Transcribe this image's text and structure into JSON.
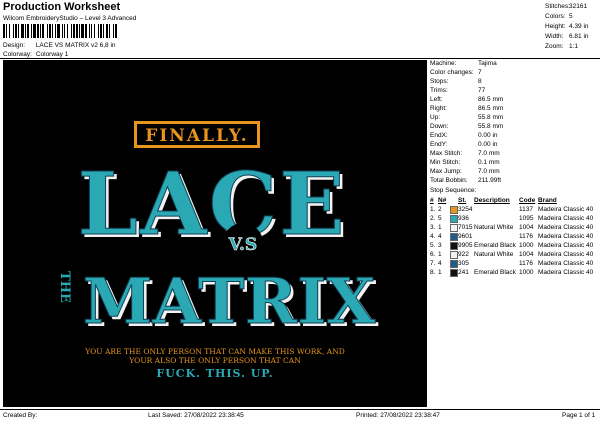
{
  "header": {
    "title": "Production Worksheet",
    "software": "Wilcom EmbroideryStudio – Level 3 Advanced"
  },
  "design_info": {
    "design_label": "Design:",
    "design_value": "LACE VS MATRIX v2 6,8 in",
    "colorway_label": "Colorway:",
    "colorway_value": "Colorway 1"
  },
  "stats": [
    {
      "key": "Stitches:",
      "value": "32161"
    },
    {
      "key": "Colors:",
      "value": "5"
    },
    {
      "key": "Height:",
      "value": "4.39 in"
    },
    {
      "key": "Width:",
      "value": "6.81 in"
    },
    {
      "key": "Zoom:",
      "value": "1:1"
    }
  ],
  "machine_info": [
    {
      "key": "Machine:",
      "value": "Tajima"
    },
    {
      "key": "Color changes:",
      "value": "7"
    },
    {
      "key": "Stops:",
      "value": "8"
    },
    {
      "key": "Trims:",
      "value": "77"
    },
    {
      "key": "Left:",
      "value": "86.5 mm"
    },
    {
      "key": "Right:",
      "value": "86.5 mm"
    },
    {
      "key": "Up:",
      "value": "55.8 mm"
    },
    {
      "key": "Down:",
      "value": "55.8 mm"
    },
    {
      "key": "EndX:",
      "value": "0.00 in"
    },
    {
      "key": "EndY:",
      "value": "0.00 in"
    },
    {
      "key": "Max Stitch:",
      "value": "7.0 mm"
    },
    {
      "key": "Min Stitch:",
      "value": "0.1 mm"
    },
    {
      "key": "Max Jump:",
      "value": "7.0 mm"
    },
    {
      "key": "Total Bobbin:",
      "value": "211.99ft"
    }
  ],
  "stop_sequence": {
    "title": "Stop Sequence:",
    "headers": [
      "#",
      "N#",
      "St.",
      "Description",
      "Code",
      "Brand"
    ],
    "rows": [
      {
        "num": "1.",
        "n": "2",
        "color": "#e8951f",
        "st": "3254",
        "desc": "",
        "code": "1137",
        "brand": "Madeira Classic 40"
      },
      {
        "num": "2.",
        "n": "5",
        "color": "#2aa9b4",
        "st": "936",
        "desc": "",
        "code": "1095",
        "brand": "Madeira Classic 40"
      },
      {
        "num": "3.",
        "n": "1",
        "color": "#f2f2f2",
        "st": "7015",
        "desc": "Natural White",
        "code": "1004",
        "brand": "Madeira Classic 40"
      },
      {
        "num": "4.",
        "n": "4",
        "color": "#1e5f8a",
        "st": "9601",
        "desc": "",
        "code": "1176",
        "brand": "Madeira Classic 40"
      },
      {
        "num": "5.",
        "n": "3",
        "color": "#111111",
        "st": "9905",
        "desc": "Emerald Black",
        "code": "1000",
        "brand": "Madeira Classic 40"
      },
      {
        "num": "6.",
        "n": "1",
        "color": "#f2f2f2",
        "st": "922",
        "desc": "Natural White",
        "code": "1004",
        "brand": "Madeira Classic 40"
      },
      {
        "num": "7.",
        "n": "4",
        "color": "#1e5f8a",
        "st": "305",
        "desc": "",
        "code": "1176",
        "brand": "Madeira Classic 40"
      },
      {
        "num": "8.",
        "n": "1",
        "color": "#111111",
        "st": "241",
        "desc": "Emerald Black",
        "code": "1000",
        "brand": "Madeira Classic 40"
      }
    ]
  },
  "artwork": {
    "finally": "FINALLY.",
    "lace": "LACE",
    "vs": "V.S",
    "the": "THE",
    "matrix": "MATRIX",
    "line1": "YOU ARE THE ONLY PERSON THAT CAN MAKE THIS WORK, AND",
    "line2": "YOUR ALSO THE ONLY PERSON THAT CAN",
    "line3": "FUCK. THIS. UP.",
    "orange": "#e8951f",
    "teal": "#2aa9b4",
    "white": "#f2f2f2"
  },
  "footer": {
    "created_by": "Created By:",
    "last_saved": "Last Saved: 27/08/2022 23:38:45",
    "printed": "Printed: 27/08/2022 23:38:47",
    "page": "Page 1 of 1"
  }
}
